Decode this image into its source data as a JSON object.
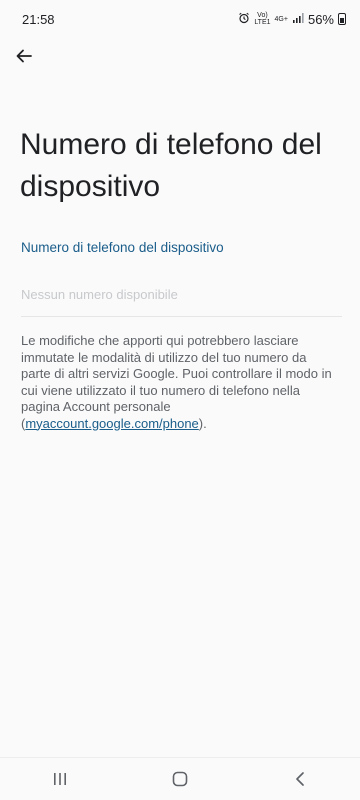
{
  "status_bar": {
    "time": "21:58",
    "network_top": "Vo)",
    "network_bottom": "LTE1",
    "network_type": "4G+",
    "battery": "56%",
    "icons": [
      "alarm-icon",
      "signal-icon",
      "battery-icon"
    ]
  },
  "toolbar": {
    "back_icon": "arrow-left-icon"
  },
  "page": {
    "title": "Numero di telefono del dispositivo",
    "section_label": "Numero di telefono del dispositivo",
    "empty_text": "Nessun numero disponibile",
    "info_prefix": "Le modifiche che apporti qui potrebbero lasciare immutate le modalità di utilizzo del tuo numero da parte di altri servizi Google. Puoi controllare il modo in cui viene utilizzato il tuo numero di telefono nella pagina Account personale (",
    "info_link": "myaccount.google.com/phone",
    "info_suffix": ")."
  },
  "nav_bar": {
    "icons": [
      "recent-apps-icon",
      "home-icon",
      "back-icon"
    ]
  },
  "colors": {
    "accent": "#1a5d8a",
    "background": "#fafafa"
  }
}
